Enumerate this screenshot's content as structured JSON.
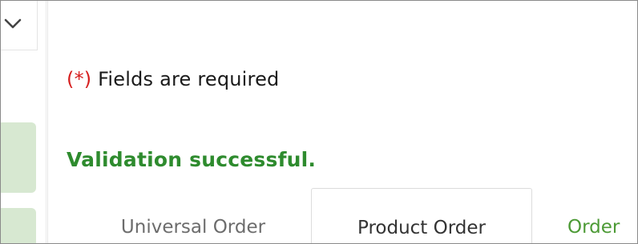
{
  "form": {
    "required_marker": "(*)",
    "required_text": " Fields are required",
    "validation_message": "Validation successful."
  },
  "tabs": [
    {
      "label": "Universal Order"
    },
    {
      "label": "Product Order"
    },
    {
      "label": "Order"
    }
  ],
  "colors": {
    "required_marker": "#d61f1f",
    "success_text": "#2e8b2e",
    "active_tab_link": "#4c9a35",
    "sidebar_block": "#d7e8d1"
  },
  "icons": {
    "collapse": "chevron-down-icon"
  }
}
